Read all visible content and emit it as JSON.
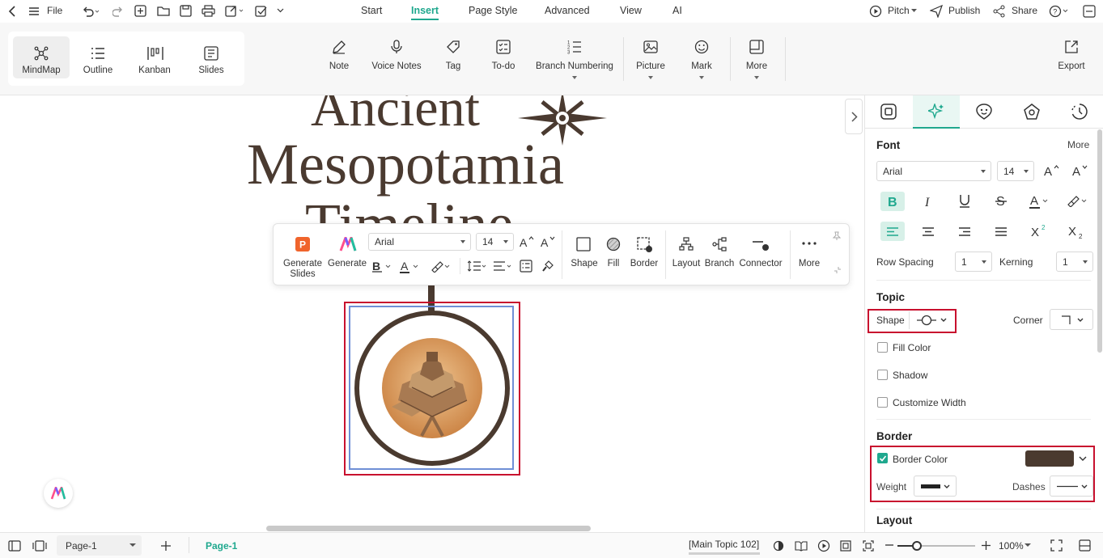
{
  "menubar": {
    "file": "File",
    "tabs": [
      "Start",
      "Insert",
      "Page Style",
      "Advanced",
      "View",
      "AI"
    ],
    "active_tab": "Insert",
    "pitch": "Pitch",
    "publish": "Publish",
    "share": "Share"
  },
  "ribbon": {
    "views": [
      "MindMap",
      "Outline",
      "Kanban",
      "Slides"
    ],
    "active_view": "MindMap",
    "tools": {
      "note": "Note",
      "voice_notes": "Voice Notes",
      "tag": "Tag",
      "todo": "To-do",
      "branch_numbering": "Branch Numbering",
      "picture": "Picture",
      "mark": "Mark",
      "more": "More"
    },
    "export": "Export"
  },
  "canvas": {
    "title_line1": "Ancient",
    "title_line2": "Mesopotamia",
    "title_line3": "Timeline"
  },
  "floatbar": {
    "generate_slides": "Generate\nSlides",
    "generate": "Generate",
    "font_family": "Arial",
    "font_size": "14",
    "shape": "Shape",
    "fill": "Fill",
    "border": "Border",
    "layout": "Layout",
    "branch": "Branch",
    "connector": "Connector",
    "more": "More"
  },
  "panel": {
    "font": {
      "title": "Font",
      "more": "More",
      "family": "Arial",
      "size": "14",
      "row_spacing_label": "Row Spacing",
      "row_spacing": "1",
      "kerning_label": "Kerning",
      "kerning": "1"
    },
    "topic": {
      "title": "Topic",
      "shape_label": "Shape",
      "corner_label": "Corner",
      "fill_color": "Fill Color",
      "shadow": "Shadow",
      "customize_width": "Customize Width"
    },
    "border": {
      "title": "Border",
      "border_color": "Border Color",
      "border_color_value": "#4a3a2f",
      "weight_label": "Weight",
      "dashes_label": "Dashes"
    },
    "layout": {
      "title": "Layout"
    }
  },
  "statusbar": {
    "page_select": "Page-1",
    "page_tab": "Page-1",
    "selection": "[Main Topic 102]",
    "zoom": "100%"
  },
  "colors": {
    "accent": "#1fa88e",
    "highlight_box": "#c8102e",
    "topic_border": "#4a3a2f",
    "selection": "#6f8fd6"
  }
}
